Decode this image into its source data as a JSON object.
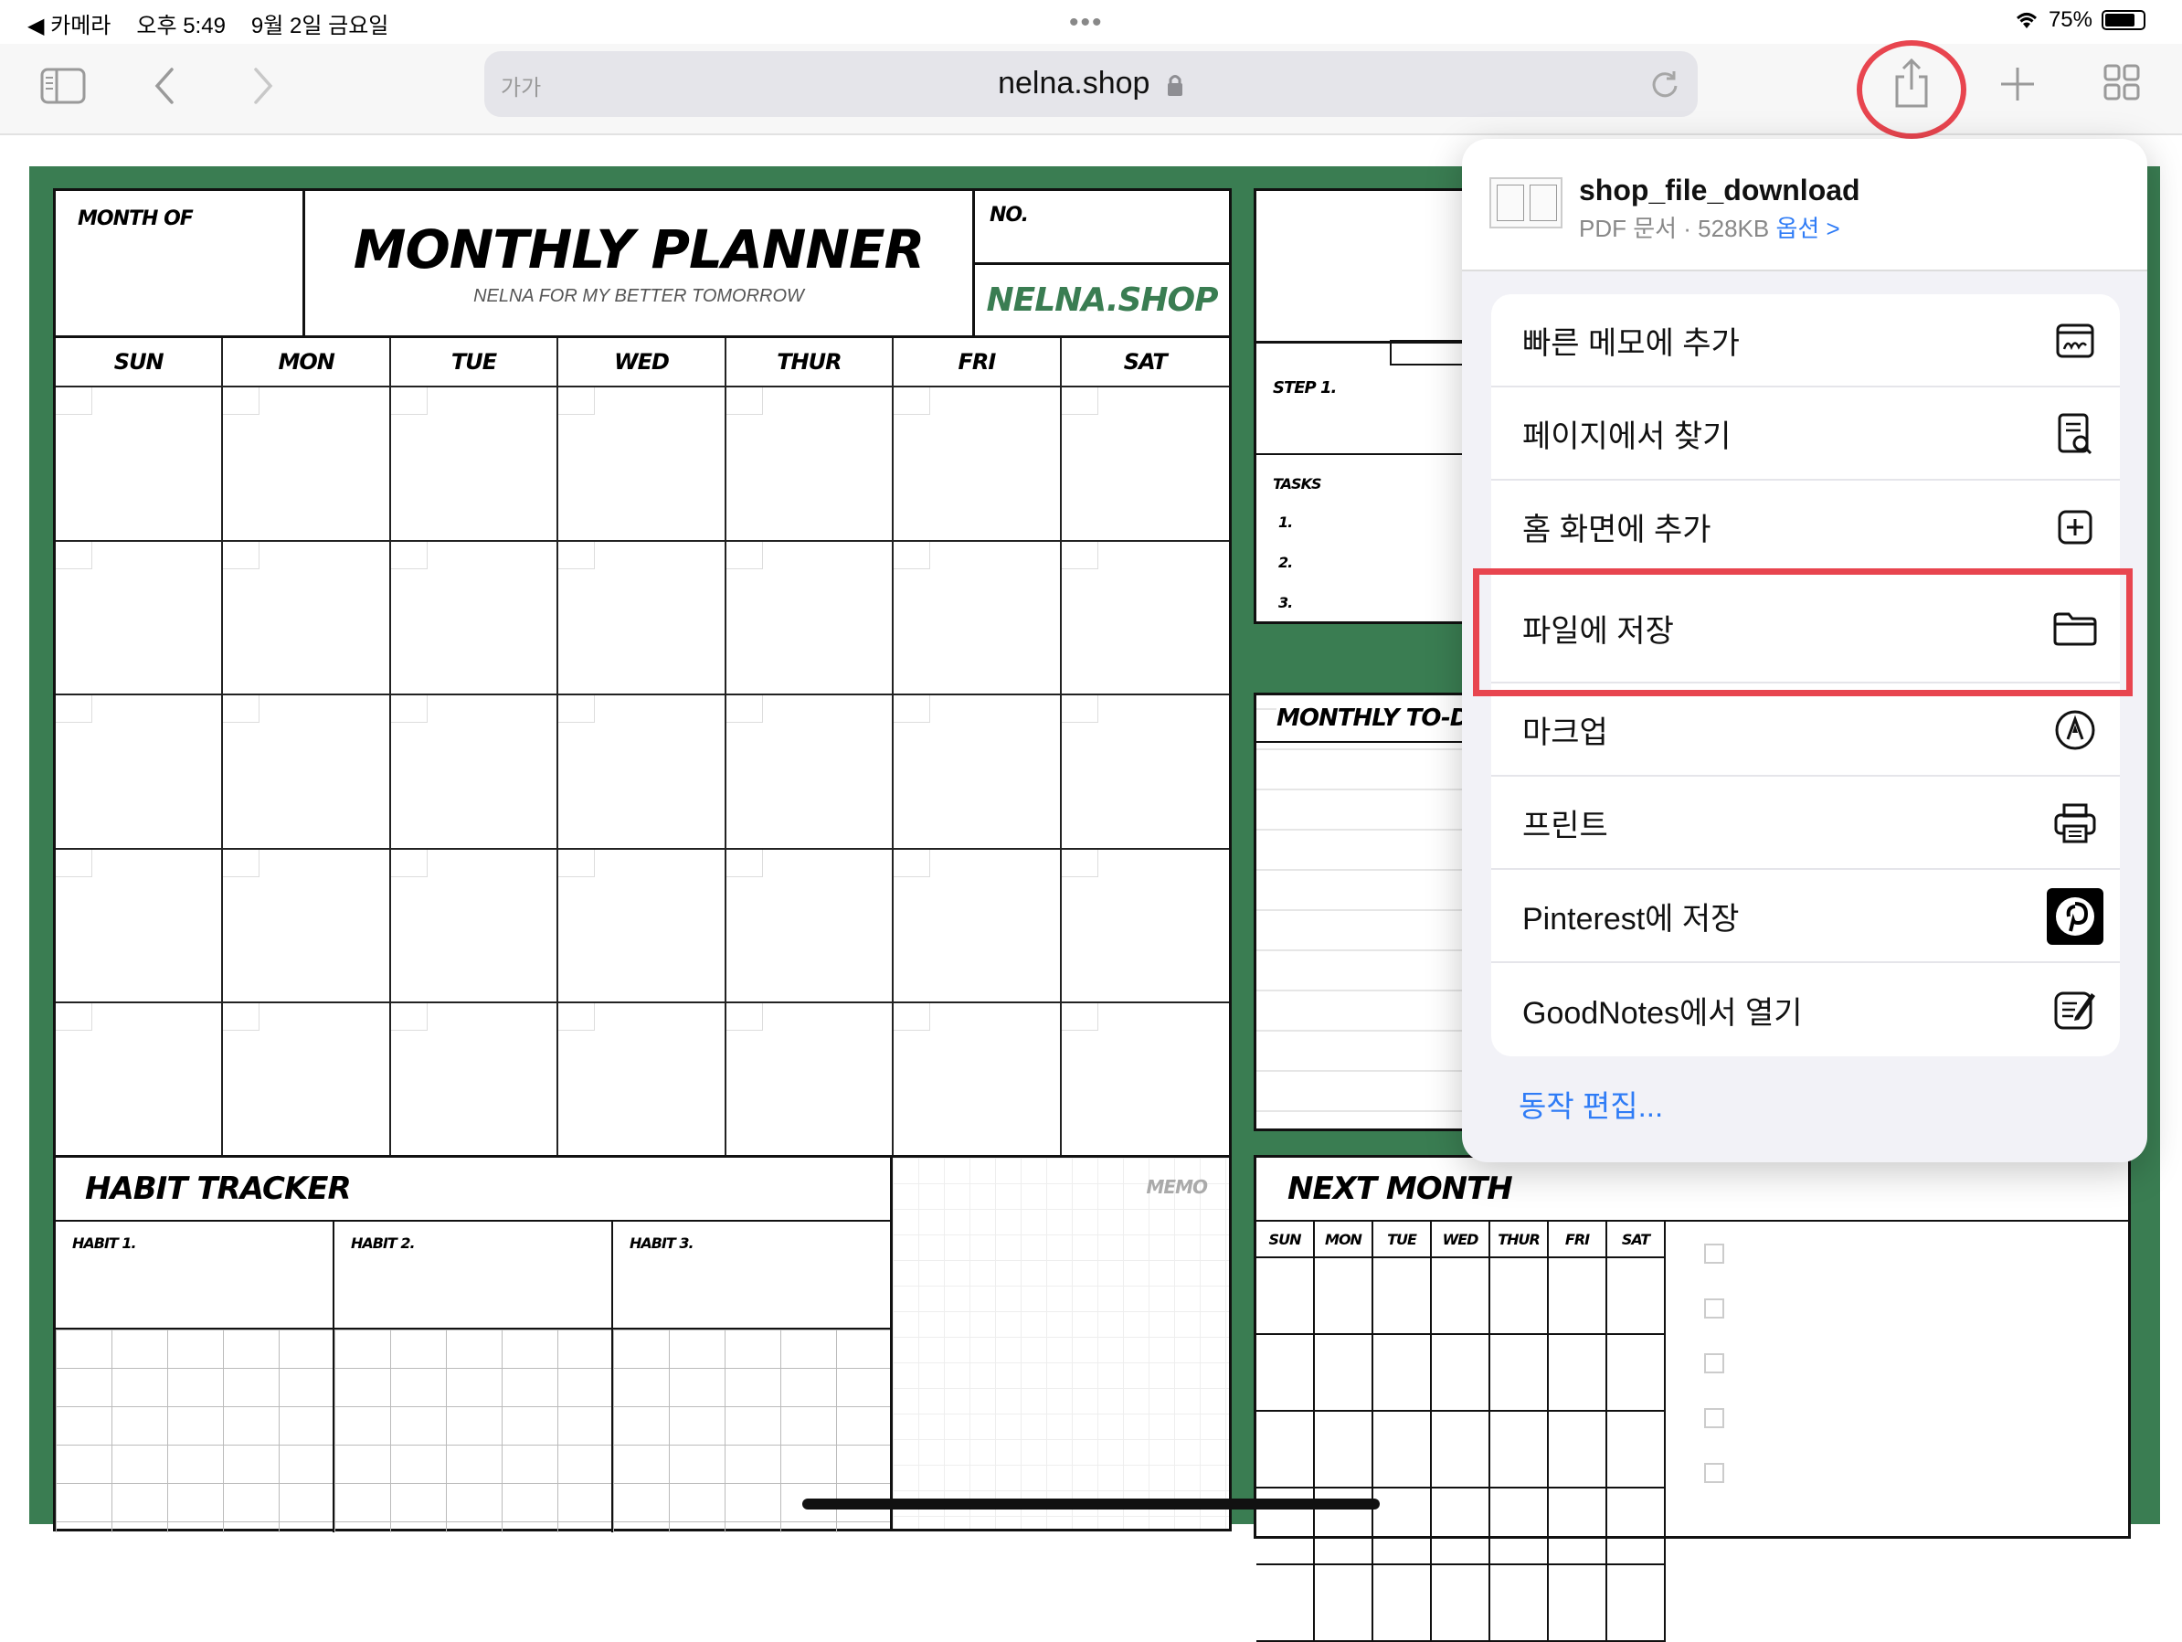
{
  "status_bar": {
    "back_app": "◀ 카메라",
    "time": "오후 5:49",
    "date": "9월 2일 금요일",
    "battery": "75%"
  },
  "browser": {
    "text_size": "가가",
    "url": "nelna.shop"
  },
  "planner": {
    "month_of": "MONTH OF",
    "title": "MONTHLY PLANNER",
    "subtitle": "NELNA FOR MY BETTER TOMORROW",
    "no": "NO.",
    "brand": "NELNA.SHOP",
    "days": [
      "SUN",
      "MON",
      "TUE",
      "WED",
      "THUR",
      "FRI",
      "SAT"
    ],
    "habit_tracker": "HABIT TRACKER",
    "habits": [
      "HABIT 1.",
      "HABIT 2.",
      "HABIT 3."
    ],
    "memo": "MEMO",
    "step": "STEP 1.",
    "tasks": "TASKS",
    "task_numbers": [
      "1.",
      "2.",
      "3."
    ],
    "monthly_todo": "MONTHLY TO-DO",
    "next_month": "NEXT MONTH"
  },
  "share_sheet": {
    "file_name": "shop_file_download",
    "file_meta": "PDF 문서 · 528KB",
    "options": "옵션 >",
    "actions": [
      {
        "label": "빠른 메모에 추가",
        "icon": "quick-note-icon"
      },
      {
        "label": "페이지에서 찾기",
        "icon": "find-in-page-icon"
      },
      {
        "label": "홈 화면에 추가",
        "icon": "add-square-icon"
      },
      {
        "label": "파일에 저장",
        "icon": "folder-icon"
      },
      {
        "label": "마크업",
        "icon": "markup-icon"
      },
      {
        "label": "프린트",
        "icon": "printer-icon"
      },
      {
        "label": "Pinterest에 저장",
        "icon": "pinterest-icon"
      },
      {
        "label": "GoodNotes에서 열기",
        "icon": "goodnotes-icon"
      }
    ],
    "edit_actions": "동작 편집..."
  },
  "colors": {
    "planner_green": "#3a7d52",
    "annotation_red": "#e8454f",
    "link_blue": "#2f7cf6"
  }
}
